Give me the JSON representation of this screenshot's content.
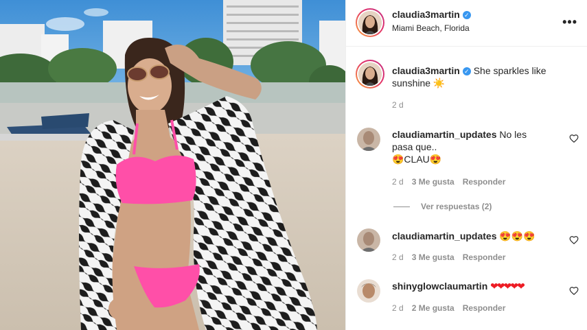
{
  "post": {
    "username": "claudia3martin",
    "location": "Miami Beach, Florida",
    "caption": "She sparkles like sunshine ☀️",
    "caption_time": "2 d"
  },
  "comments": [
    {
      "username": "claudiamartin_updates",
      "text_line1": "No les",
      "text_line2": "pasa que..",
      "text_line3": "😍CLAU😍",
      "time": "2 d",
      "likes": "3 Me gusta",
      "reply_label": "Responder",
      "view_replies": "Ver respuestas (2)"
    },
    {
      "username": "claudiamartin_updates",
      "text": "😍😍😍",
      "time": "2 d",
      "likes": "3 Me gusta",
      "reply_label": "Responder"
    },
    {
      "username": "shinyglowclaumartin",
      "text": "❤❤❤❤❤",
      "time": "2 d",
      "likes": "2 Me gusta",
      "reply_label": "Responder"
    }
  ],
  "icons": {
    "more": "more-options-icon",
    "verified": "verified-badge-icon",
    "heart": "heart-outline-icon"
  },
  "colors": {
    "verified_blue": "#3897f0",
    "muted_gray": "#8e8e8e",
    "bikini_pink": "#ff4fa8"
  }
}
